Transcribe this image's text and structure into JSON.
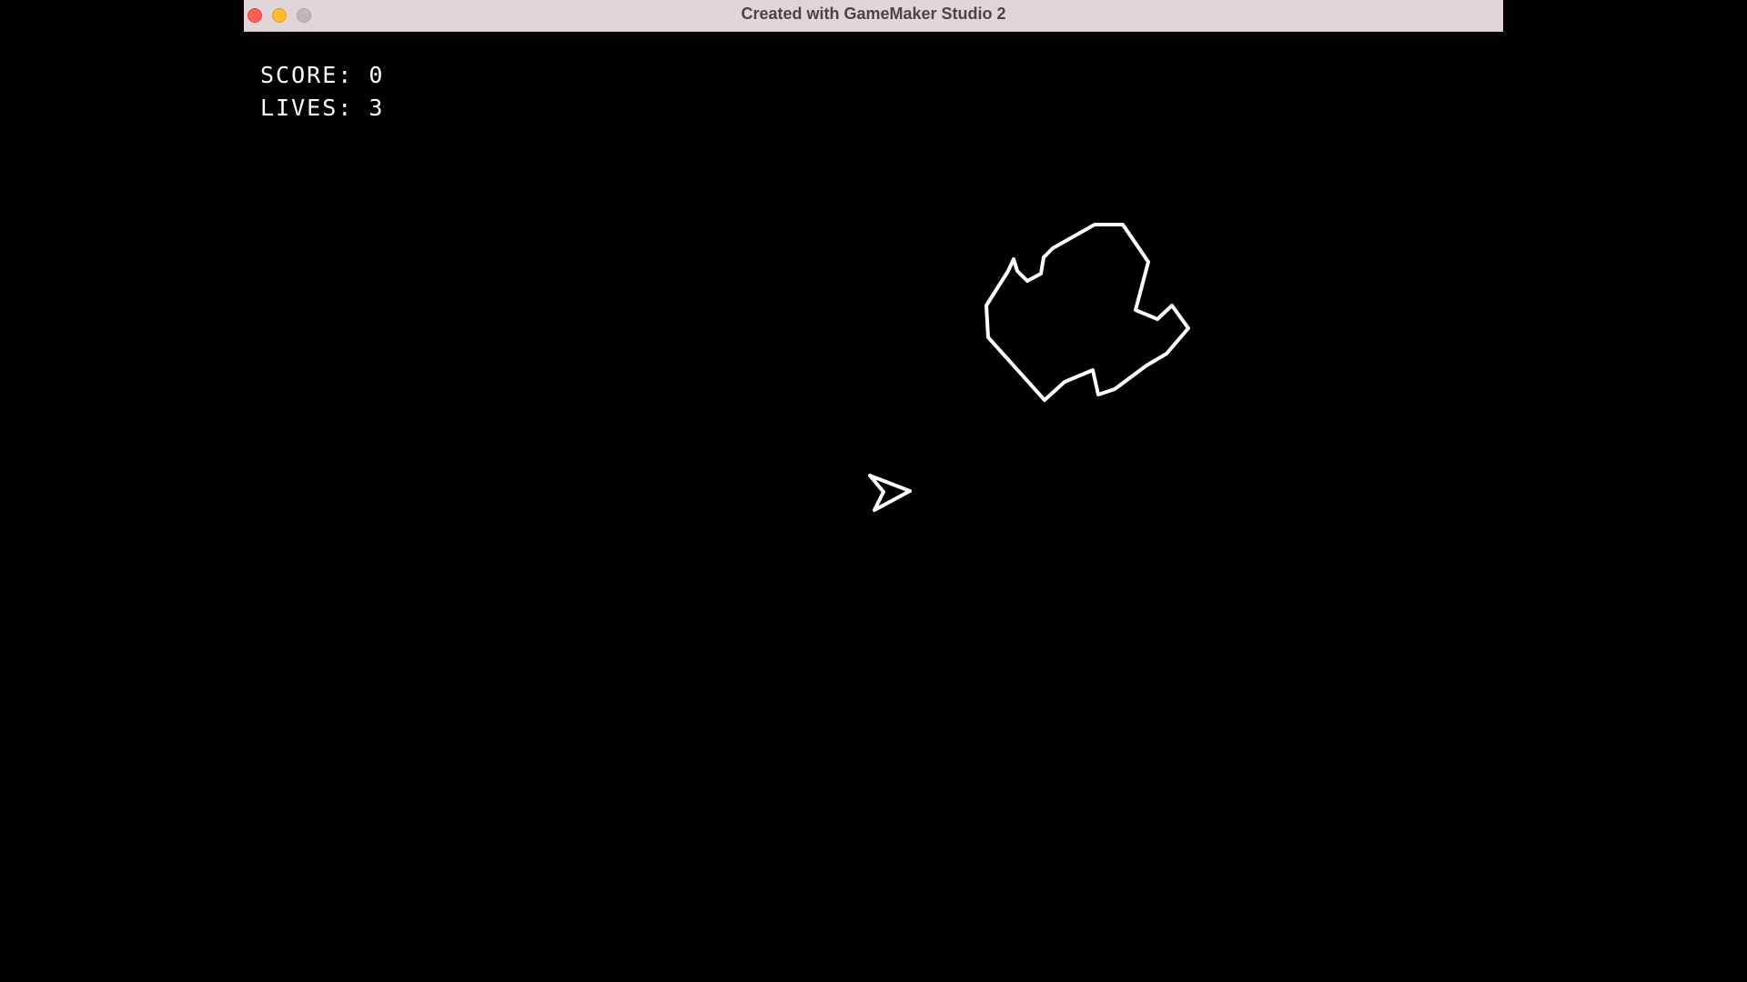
{
  "window": {
    "title": "Created with GameMaker Studio 2"
  },
  "hud": {
    "score_label": "SCORE:",
    "score_value": "0",
    "lives_label": "LIVES:",
    "lives_value": "3"
  },
  "colors": {
    "background": "#000000",
    "foreground": "#ffffff",
    "titlebar": "#e0d6da"
  }
}
